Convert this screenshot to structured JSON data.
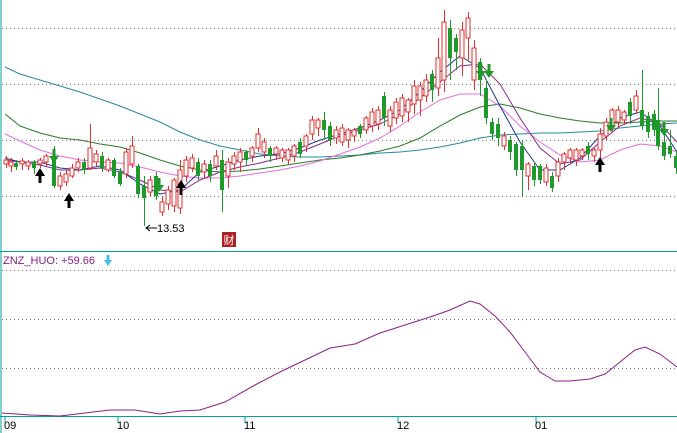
{
  "colors": {
    "background": "#ffffff",
    "frame": "#00a0a0",
    "grid": "#7a7a7a",
    "candle_up": "#e03030",
    "candle_down": "#1e9a2a",
    "ma_short": "#1d3b8c",
    "ma_mid": "#8a2a8a",
    "ma_pink": "#e070e0",
    "ma_green": "#2a7a2a",
    "ma_teal": "#2a8a9a",
    "indicator_line": "#8a208a",
    "indicator_label": "#8a208a",
    "indicator_arrow": "#40c0e0",
    "annotation": "#000000",
    "badge_bg": "#b02020",
    "badge_fg": "#ffffff"
  },
  "indicator": {
    "label": "ZNZ_HUO: +59.66",
    "arrow_icon": "down-arrow-icon"
  },
  "annotations": {
    "low_price": "13.53",
    "badge": "财"
  },
  "chart_data": [
    {
      "type": "candlestick",
      "panel": "price",
      "title": "",
      "x_tick_labels": [
        "09",
        "10",
        "11",
        "12",
        "01"
      ],
      "ylim": [
        12.9,
        19.8
      ],
      "grid": "horizontal dotted",
      "legend": "none",
      "low_annotation": 13.53,
      "buy_signals": 4,
      "sell_signals": 6,
      "moving_averages": [
        "short",
        "mid",
        "pink",
        "green",
        "teal"
      ]
    },
    {
      "type": "line",
      "panel": "indicator",
      "series": [
        {
          "name": "ZNZ_HUO",
          "last_value": 59.66
        }
      ],
      "ylim": [
        0,
        100
      ],
      "grid": "horizontal dotted",
      "legend": "top-left"
    }
  ]
}
